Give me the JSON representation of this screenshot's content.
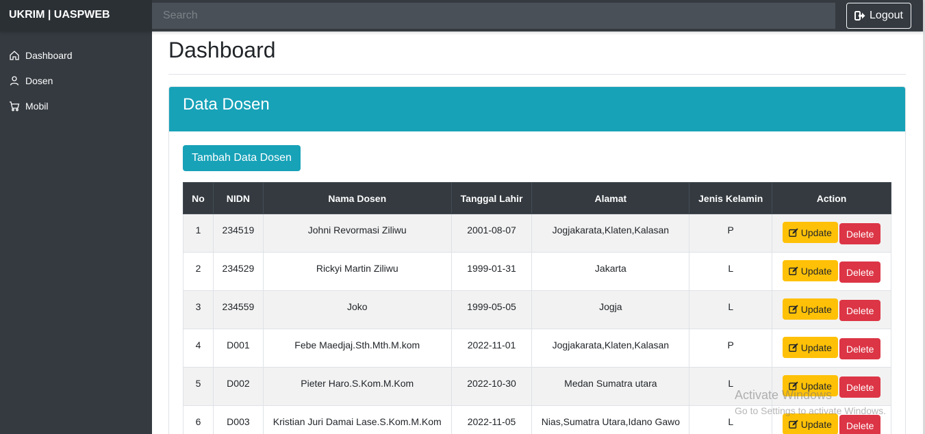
{
  "navbar": {
    "brand": "UKRIM | UASPWEB",
    "search_placeholder": "Search",
    "logout_label": "Logout"
  },
  "sidebar": {
    "items": [
      {
        "label": "Dashboard",
        "icon": "home-icon"
      },
      {
        "label": "Dosen",
        "icon": "user-icon"
      },
      {
        "label": "Mobil",
        "icon": "cart-icon"
      }
    ]
  },
  "page": {
    "title": "Dashboard",
    "card_title": "Data Dosen",
    "add_button": "Tambah Data Dosen"
  },
  "table": {
    "headers": [
      "No",
      "NIDN",
      "Nama Dosen",
      "Tanggal Lahir",
      "Alamat",
      "Jenis Kelamin",
      "Action"
    ],
    "rows": [
      [
        "1",
        "234519",
        "Johni Revormasi Ziliwu",
        "2001-08-07",
        "Jogjakarata,Klaten,Kalasan",
        "P"
      ],
      [
        "2",
        "234529",
        "Rickyi Martin Ziliwu",
        "1999-01-31",
        "Jakarta",
        "L"
      ],
      [
        "3",
        "234559",
        "Joko",
        "1999-05-05",
        "Jogja",
        "L"
      ],
      [
        "4",
        "D001",
        "Febe Maedjaj.Sth.Mth.M.kom",
        "2022-11-01",
        "Jogjakarata,Klaten,Kalasan",
        "P"
      ],
      [
        "5",
        "D002",
        "Pieter Haro.S.Kom.M.Kom",
        "2022-10-30",
        "Medan Sumatra utara",
        "L"
      ],
      [
        "6",
        "D003",
        "Kristian Juri Damai Lase.S.Kom.M.Kom",
        "2022-11-05",
        "Nias,Sumatra Utara,Idano Gawo",
        "L"
      ]
    ],
    "update_label": "Update",
    "delete_label": "Delete"
  },
  "watermark": {
    "line1": "Activate Windows",
    "line2": "Go to Settings to activate Windows."
  },
  "colors": {
    "navbar": "#343a40",
    "info": "#17a2b8",
    "warning": "#ffc107",
    "danger": "#dc3545"
  }
}
